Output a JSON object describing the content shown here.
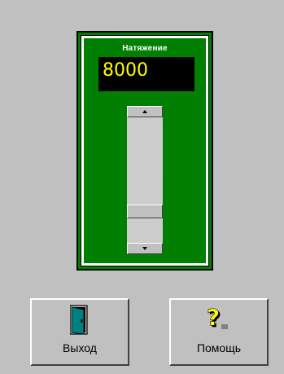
{
  "tension_panel": {
    "title": "Натяжение",
    "value": "8000",
    "slider_fraction": 0.78
  },
  "buttons": {
    "exit_label": "Выход",
    "help_label": "Помощь"
  },
  "icons": {
    "exit": "door-exit-icon",
    "help": "question-help-icon",
    "scroll_up": "arrow-up-icon",
    "scroll_down": "arrow-down-icon"
  },
  "colors": {
    "background": "#c0c0c0",
    "panel": "#007f00",
    "display_bg": "#000000",
    "display_text": "#ffff00",
    "title_text": "#ffffff"
  }
}
